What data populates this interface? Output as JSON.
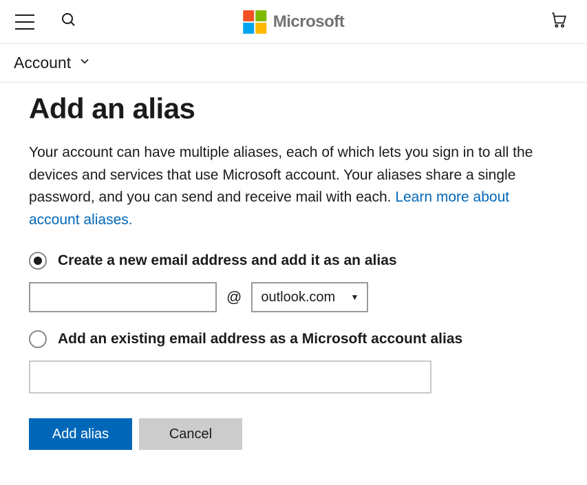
{
  "header": {
    "brand": "Microsoft"
  },
  "secondary_nav": {
    "label": "Account"
  },
  "page": {
    "title": "Add an alias",
    "description": "Your account can have multiple aliases, each of which lets you sign in to all the devices and services that use Microsoft account. Your aliases share a single password, and you can send and receive mail with each. ",
    "learn_more": "Learn more about account aliases."
  },
  "options": {
    "create_label": "Create a new email address and add it as an alias",
    "existing_label": "Add an existing email address as a Microsoft account alias",
    "selected": "create",
    "new_email_value": "",
    "at": "@",
    "domain_value": "outlook.com",
    "existing_email_value": ""
  },
  "buttons": {
    "primary": "Add alias",
    "secondary": "Cancel"
  }
}
